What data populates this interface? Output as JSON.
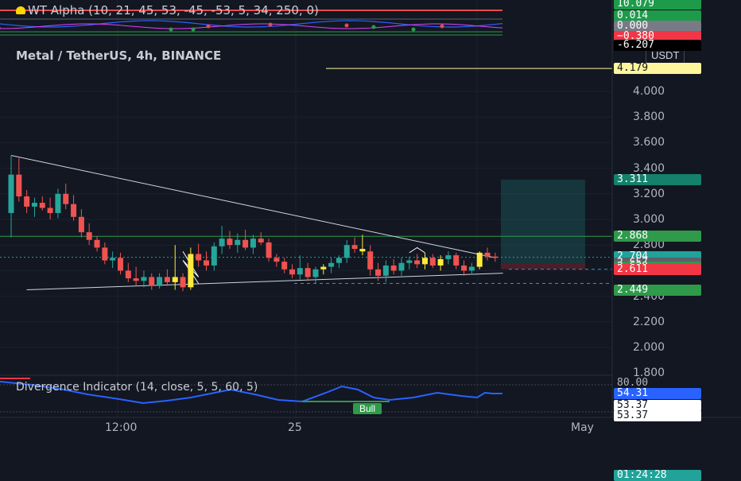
{
  "indicator_top": {
    "name": "WT Alpha (10, 21, 45, 53, -45, -53, 5, 34, 250, 0)"
  },
  "main_title": "Metal / TetherUS, 4h, BINANCE",
  "currency_button": "USDT",
  "indicator_bottom": {
    "name": "Divergence Indicator (14, close, 5, 5, 60, 5)",
    "bull_label": "Bull"
  },
  "top_scale_labels": [
    {
      "text": "10.079",
      "color": "#1e9b4a"
    },
    {
      "text": "0.014",
      "color": "#1e9b4a"
    },
    {
      "text": "0.000",
      "color": "#787b86"
    },
    {
      "text": "−0.380",
      "color": "#f23645"
    },
    {
      "text": "-6.207",
      "color": "#000000"
    }
  ],
  "price_axis_ticks": [
    "4.000",
    "3.800",
    "3.600",
    "3.400",
    "3.200",
    "3.000",
    "2.800",
    "2.600",
    "2.400",
    "2.200",
    "2.000",
    "1.800"
  ],
  "price_labels": [
    {
      "text": "4.179",
      "bg": "#fff59d",
      "fg": "#131722"
    },
    {
      "text": "3.311",
      "bg": "#15806b",
      "fg": "#ffffff"
    },
    {
      "text": "2.868",
      "bg": "#2e9a4a",
      "fg": "#ffffff"
    },
    {
      "text": "2.704",
      "bg": "#22a39a",
      "fg": "#ffffff"
    },
    {
      "text": "01:24:28",
      "bg": "#22a39a",
      "fg": "#ffffff"
    },
    {
      "text": "2.657",
      "bg": "#5d606b",
      "fg": "#ffffff"
    },
    {
      "text": "2.629",
      "bg": "#2e9a4a",
      "fg": "#ffffff"
    },
    {
      "text": "2.611",
      "bg": "#f23645",
      "fg": "#ffffff"
    },
    {
      "text": "2.449",
      "bg": "#2e9a4a",
      "fg": "#ffffff"
    }
  ],
  "lower_scale_labels": [
    {
      "text": "80.00",
      "bg": "#131722",
      "fg": "#b2b5be"
    },
    {
      "text": "54.31",
      "bg": "#2962ff",
      "fg": "#ffffff"
    },
    {
      "text": "53.37",
      "bg": "#ffffff",
      "fg": "#131722"
    },
    {
      "text": "53.37",
      "bg": "#ffffff",
      "fg": "#131722"
    }
  ],
  "time_axis": [
    "12:00",
    "25",
    "May"
  ],
  "colors": {
    "up": "#26a69a",
    "down": "#ef5350",
    "highlight": "#ffeb3b",
    "bg": "#131722",
    "divergence_line": "#2962ff"
  },
  "chart_data": {
    "type": "candlestick",
    "title": "Metal / TetherUS, 4h, BINANCE",
    "ylim": [
      1.8,
      4.2
    ],
    "candles": [
      {
        "o": 3.05,
        "h": 3.5,
        "l": 2.86,
        "c": 3.35
      },
      {
        "o": 3.35,
        "h": 3.48,
        "l": 3.14,
        "c": 3.18
      },
      {
        "o": 3.18,
        "h": 3.23,
        "l": 3.05,
        "c": 3.1
      },
      {
        "o": 3.1,
        "h": 3.17,
        "l": 3.02,
        "c": 3.13
      },
      {
        "o": 3.13,
        "h": 3.18,
        "l": 3.07,
        "c": 3.09
      },
      {
        "o": 3.09,
        "h": 3.17,
        "l": 3.0,
        "c": 3.05
      },
      {
        "o": 3.05,
        "h": 3.24,
        "l": 3.01,
        "c": 3.2
      },
      {
        "o": 3.2,
        "h": 3.28,
        "l": 3.08,
        "c": 3.12
      },
      {
        "o": 3.12,
        "h": 3.19,
        "l": 2.99,
        "c": 3.02
      },
      {
        "o": 3.02,
        "h": 3.08,
        "l": 2.86,
        "c": 2.9
      },
      {
        "o": 2.9,
        "h": 2.97,
        "l": 2.8,
        "c": 2.84
      },
      {
        "o": 2.84,
        "h": 2.87,
        "l": 2.75,
        "c": 2.78
      },
      {
        "o": 2.78,
        "h": 2.82,
        "l": 2.65,
        "c": 2.68
      },
      {
        "o": 2.68,
        "h": 2.75,
        "l": 2.62,
        "c": 2.7
      },
      {
        "o": 2.7,
        "h": 2.74,
        "l": 2.57,
        "c": 2.6
      },
      {
        "o": 2.6,
        "h": 2.66,
        "l": 2.51,
        "c": 2.54
      },
      {
        "o": 2.54,
        "h": 2.63,
        "l": 2.48,
        "c": 2.52
      },
      {
        "o": 2.52,
        "h": 2.6,
        "l": 2.47,
        "c": 2.55
      },
      {
        "o": 2.55,
        "h": 2.58,
        "l": 2.45,
        "c": 2.48
      },
      {
        "o": 2.48,
        "h": 2.58,
        "l": 2.46,
        "c": 2.55
      },
      {
        "o": 2.55,
        "h": 2.61,
        "l": 2.48,
        "c": 2.51
      },
      {
        "o": 2.51,
        "h": 2.8,
        "l": 2.45,
        "c": 2.55
      },
      {
        "o": 2.55,
        "h": 2.58,
        "l": 2.44,
        "c": 2.47
      },
      {
        "o": 2.47,
        "h": 2.78,
        "l": 2.45,
        "c": 2.73
      },
      {
        "o": 2.73,
        "h": 2.81,
        "l": 2.63,
        "c": 2.68
      },
      {
        "o": 2.68,
        "h": 2.75,
        "l": 2.6,
        "c": 2.64
      },
      {
        "o": 2.64,
        "h": 2.82,
        "l": 2.6,
        "c": 2.79
      },
      {
        "o": 2.79,
        "h": 2.95,
        "l": 2.73,
        "c": 2.85
      },
      {
        "o": 2.85,
        "h": 2.91,
        "l": 2.77,
        "c": 2.8
      },
      {
        "o": 2.8,
        "h": 2.89,
        "l": 2.74,
        "c": 2.84
      },
      {
        "o": 2.84,
        "h": 2.92,
        "l": 2.76,
        "c": 2.78
      },
      {
        "o": 2.78,
        "h": 2.88,
        "l": 2.73,
        "c": 2.85
      },
      {
        "o": 2.85,
        "h": 2.9,
        "l": 2.8,
        "c": 2.82
      },
      {
        "o": 2.82,
        "h": 2.85,
        "l": 2.67,
        "c": 2.7
      },
      {
        "o": 2.7,
        "h": 2.73,
        "l": 2.63,
        "c": 2.67
      },
      {
        "o": 2.67,
        "h": 2.7,
        "l": 2.58,
        "c": 2.61
      },
      {
        "o": 2.61,
        "h": 2.65,
        "l": 2.54,
        "c": 2.57
      },
      {
        "o": 2.57,
        "h": 2.72,
        "l": 2.53,
        "c": 2.62
      },
      {
        "o": 2.62,
        "h": 2.66,
        "l": 2.52,
        "c": 2.55
      },
      {
        "o": 2.55,
        "h": 2.63,
        "l": 2.5,
        "c": 2.61
      },
      {
        "o": 2.61,
        "h": 2.65,
        "l": 2.57,
        "c": 2.63
      },
      {
        "o": 2.63,
        "h": 2.7,
        "l": 2.58,
        "c": 2.66
      },
      {
        "o": 2.66,
        "h": 2.72,
        "l": 2.62,
        "c": 2.7
      },
      {
        "o": 2.7,
        "h": 2.84,
        "l": 2.66,
        "c": 2.8
      },
      {
        "o": 2.8,
        "h": 2.86,
        "l": 2.74,
        "c": 2.77
      },
      {
        "o": 2.77,
        "h": 2.88,
        "l": 2.72,
        "c": 2.75
      },
      {
        "o": 2.75,
        "h": 2.8,
        "l": 2.56,
        "c": 2.61
      },
      {
        "o": 2.61,
        "h": 2.66,
        "l": 2.52,
        "c": 2.56
      },
      {
        "o": 2.56,
        "h": 2.68,
        "l": 2.51,
        "c": 2.64
      },
      {
        "o": 2.64,
        "h": 2.69,
        "l": 2.57,
        "c": 2.6
      },
      {
        "o": 2.6,
        "h": 2.7,
        "l": 2.56,
        "c": 2.66
      },
      {
        "o": 2.66,
        "h": 2.71,
        "l": 2.61,
        "c": 2.68
      },
      {
        "o": 2.68,
        "h": 2.73,
        "l": 2.62,
        "c": 2.65
      },
      {
        "o": 2.65,
        "h": 2.74,
        "l": 2.61,
        "c": 2.7
      },
      {
        "o": 2.7,
        "h": 2.73,
        "l": 2.62,
        "c": 2.64
      },
      {
        "o": 2.64,
        "h": 2.72,
        "l": 2.6,
        "c": 2.69
      },
      {
        "o": 2.69,
        "h": 2.75,
        "l": 2.65,
        "c": 2.72
      },
      {
        "o": 2.72,
        "h": 2.74,
        "l": 2.61,
        "c": 2.64
      },
      {
        "o": 2.64,
        "h": 2.68,
        "l": 2.56,
        "c": 2.6
      },
      {
        "o": 2.6,
        "h": 2.66,
        "l": 2.57,
        "c": 2.63
      },
      {
        "o": 2.63,
        "h": 2.75,
        "l": 2.61,
        "c": 2.74
      },
      {
        "o": 2.74,
        "h": 2.78,
        "l": 2.68,
        "c": 2.71
      },
      {
        "o": 2.71,
        "h": 2.74,
        "l": 2.67,
        "c": 2.7
      }
    ],
    "highlighted_candles": [
      21,
      23,
      40,
      45,
      53,
      55,
      60
    ],
    "trendlines": [
      {
        "from": [
          0,
          3.5
        ],
        "to": [
          62,
          2.7
        ]
      },
      {
        "from": [
          2,
          2.45
        ],
        "to": [
          63,
          2.58
        ]
      }
    ],
    "horizontal_levels": [
      4.179,
      2.868,
      2.704,
      2.657,
      2.611
    ],
    "long_position": {
      "entry": 2.657,
      "target": 3.311,
      "stop": 2.611
    }
  }
}
